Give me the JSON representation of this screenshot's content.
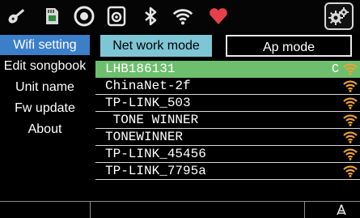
{
  "top_icons": [
    "guitar-icon",
    "sd-card-icon",
    "record-icon",
    "speaker-icon",
    "bluetooth-icon",
    "wifi-icon",
    "heart-icon",
    "settings-gear-icon"
  ],
  "sidebar": {
    "items": [
      {
        "label": "Wifi setting",
        "active": true
      },
      {
        "label": "Edit songbook",
        "active": false
      },
      {
        "label": "Unit name",
        "active": false
      },
      {
        "label": "Fw update",
        "active": false
      },
      {
        "label": "About",
        "active": false
      }
    ]
  },
  "tabs": {
    "net_work_mode": "Net work mode",
    "ap_mode": "Ap mode"
  },
  "networks": [
    {
      "ssid": "LHB186131",
      "status": "C",
      "selected": true
    },
    {
      "ssid": "ChinaNet-2f",
      "status": "",
      "selected": false
    },
    {
      "ssid": "TP-LINK_503",
      "status": "",
      "selected": false
    },
    {
      "ssid": " TONE WINNER",
      "status": "",
      "selected": false
    },
    {
      "ssid": "TONEWINNER",
      "status": "",
      "selected": false
    },
    {
      "ssid": "TP-LINK_45456",
      "status": "",
      "selected": false
    },
    {
      "ssid": "TP-LINK_7795a",
      "status": "",
      "selected": false
    }
  ],
  "colors": {
    "sidebar_active": "#3c7fc9",
    "tab_active": "#7ec6d6",
    "row_selected": "#6dbf6e",
    "wifi_signal": "#f0a030",
    "heart": "#e8404a"
  }
}
